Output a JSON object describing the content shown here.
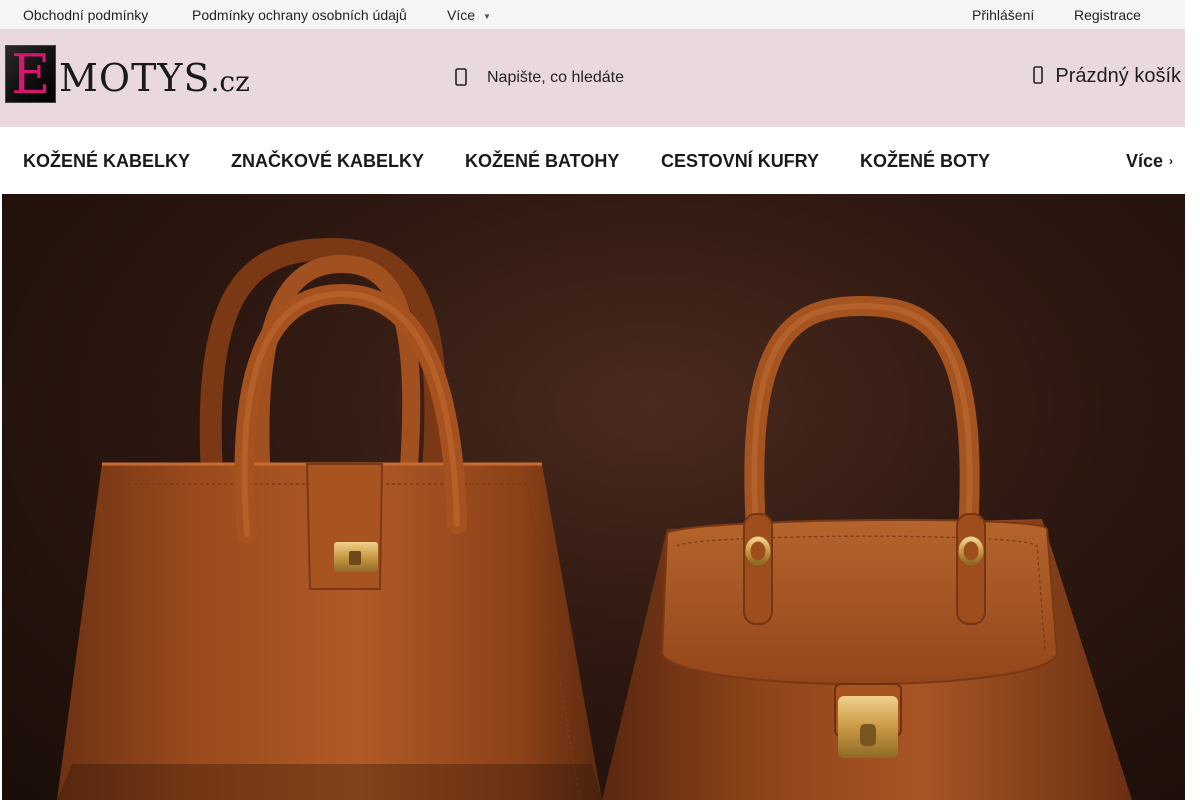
{
  "topbar": {
    "links": [
      {
        "label": "Obchodní podmínky"
      },
      {
        "label": "Podmínky ochrany osobních údajů"
      }
    ],
    "more_label": "Více",
    "login_label": "Přihlášení",
    "register_label": "Registrace"
  },
  "header": {
    "logo": {
      "initial": "E",
      "text": "MOTYS",
      "suffix": ".cz"
    },
    "search": {
      "placeholder": "Napište, co hledáte",
      "icon": "search-icon"
    },
    "cart": {
      "label": "Prázdný košík",
      "icon": "cart-icon"
    }
  },
  "nav": {
    "items": [
      {
        "label": "KOŽENÉ KABELKY"
      },
      {
        "label": "ZNAČKOVÉ KABELKY"
      },
      {
        "label": "KOŽENÉ BATOHY"
      },
      {
        "label": "CESTOVNÍ KUFRY"
      },
      {
        "label": "KOŽENÉ BOTY"
      }
    ],
    "more_label": "Více"
  },
  "colors": {
    "header_bg": "#ead9dc",
    "topbar_bg": "#f5f5f5",
    "logo_accent": "#d4176e",
    "leather": "#a4501f"
  }
}
